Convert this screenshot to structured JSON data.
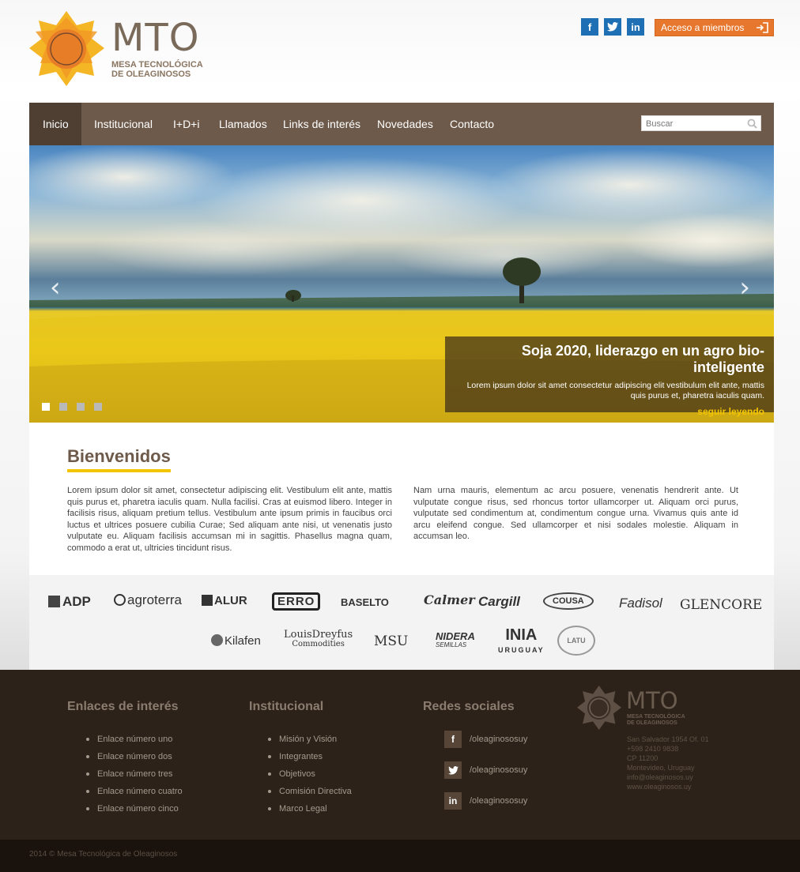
{
  "brand": {
    "title": "MTO",
    "subtitle_line1": "MESA TECNOLÓGICA",
    "subtitle_line2": "DE OLEAGINOSOS",
    "accent": "#e8772e",
    "yellow": "#f2c500",
    "brown": "#6e5a4a"
  },
  "header": {
    "social": [
      {
        "icon": "facebook-icon",
        "glyph": "f"
      },
      {
        "icon": "twitter-icon",
        "glyph": "t"
      },
      {
        "icon": "linkedin-icon",
        "glyph": "in"
      }
    ],
    "members_label": "Acceso a miembros"
  },
  "nav": {
    "items": [
      {
        "label": "Inicio",
        "active": true
      },
      {
        "label": "Institucional"
      },
      {
        "label": "I+D+i"
      },
      {
        "label": "Llamados"
      },
      {
        "label": "Links de interés"
      },
      {
        "label": "Novedades"
      },
      {
        "label": "Contacto"
      }
    ],
    "search_placeholder": "Buscar"
  },
  "hero": {
    "title": "Soja 2020, liderazgo en un agro bio-inteligente",
    "text": "Lorem ipsum dolor sit amet consectetur adipiscing elit vestibulum elit ante, mattis quis purus et, pharetra iaculis quam.",
    "more": "seguir leyendo",
    "prev": "‹",
    "next": "›",
    "slides_total": 4,
    "slide_active": 1
  },
  "welcome": {
    "heading": "Bienvenidos",
    "col1": "Lorem ipsum dolor sit amet, consectetur adipiscing elit. Vestibulum elit ante, mattis quis purus et, pharetra iaculis quam. Nulla facilisi. Cras at euismod libero. Integer in facilisis risus, aliquam pretium tellus. Vestibulum ante ipsum primis in faucibus orci luctus et ultrices posuere cubilia Curae; Sed aliquam ante nisi, ut venenatis justo vulputate eu. Aliquam facilisis accumsan mi in sagittis. Phasellus magna quam, commodo a erat ut, ultricies tincidunt risus.",
    "col2": "Nam urna mauris, elementum ac arcu posuere, venenatis hendrerit ante. Ut vulputate congue risus, sed rhoncus tortor ullamcorper ut. Aliquam orci purus, vulputate sed condimentum at, condimentum congue urna. Vivamus quis ante id arcu eleifend congue. Sed ullamcorper et nisi sodales molestie. Aliquam in accumsan leo."
  },
  "partners": {
    "row1": [
      "ADP",
      "agroterra",
      "ALUR",
      "ERRO",
      "BASELTO",
      "Calmer",
      "Cargill",
      "COUSA",
      "Fadisol",
      "GLENCORE"
    ],
    "row2": [
      "Kilafen",
      "LouisDreyfus",
      "Commodities",
      "MSU",
      "NIDERA",
      "SEMILLAS",
      "INIA",
      "URUGUAY",
      "LATU"
    ]
  },
  "footer": {
    "links_heading": "Enlaces de interés",
    "links": [
      "Enlace número uno",
      "Enlace número dos",
      "Enlace número tres",
      "Enlace número cuatro",
      "Enlace número cinco"
    ],
    "inst_heading": "Institucional",
    "inst": [
      "Misión y Visión",
      "Integrantes",
      "Objetivos",
      "Comisión Directiva",
      "Marco Legal"
    ],
    "social_heading": "Redes sociales",
    "social": [
      {
        "icon": "facebook-icon",
        "glyph": "f",
        "handle": "/oleaginososuy"
      },
      {
        "icon": "twitter-icon",
        "glyph": "t",
        "handle": "/oleaginososuy"
      },
      {
        "icon": "linkedin-icon",
        "glyph": "in",
        "handle": "/oleaginososuy"
      }
    ],
    "address": [
      "San Salvador 1954 Of. 01",
      "+598 2410 9838",
      "CP 11200",
      "Montevideo, Uruguay",
      "info@oleaginosos.uy",
      "www.oleaginosos.uy"
    ],
    "copyright": "2014 © Mesa Tecnológica de Oleaginosos"
  }
}
